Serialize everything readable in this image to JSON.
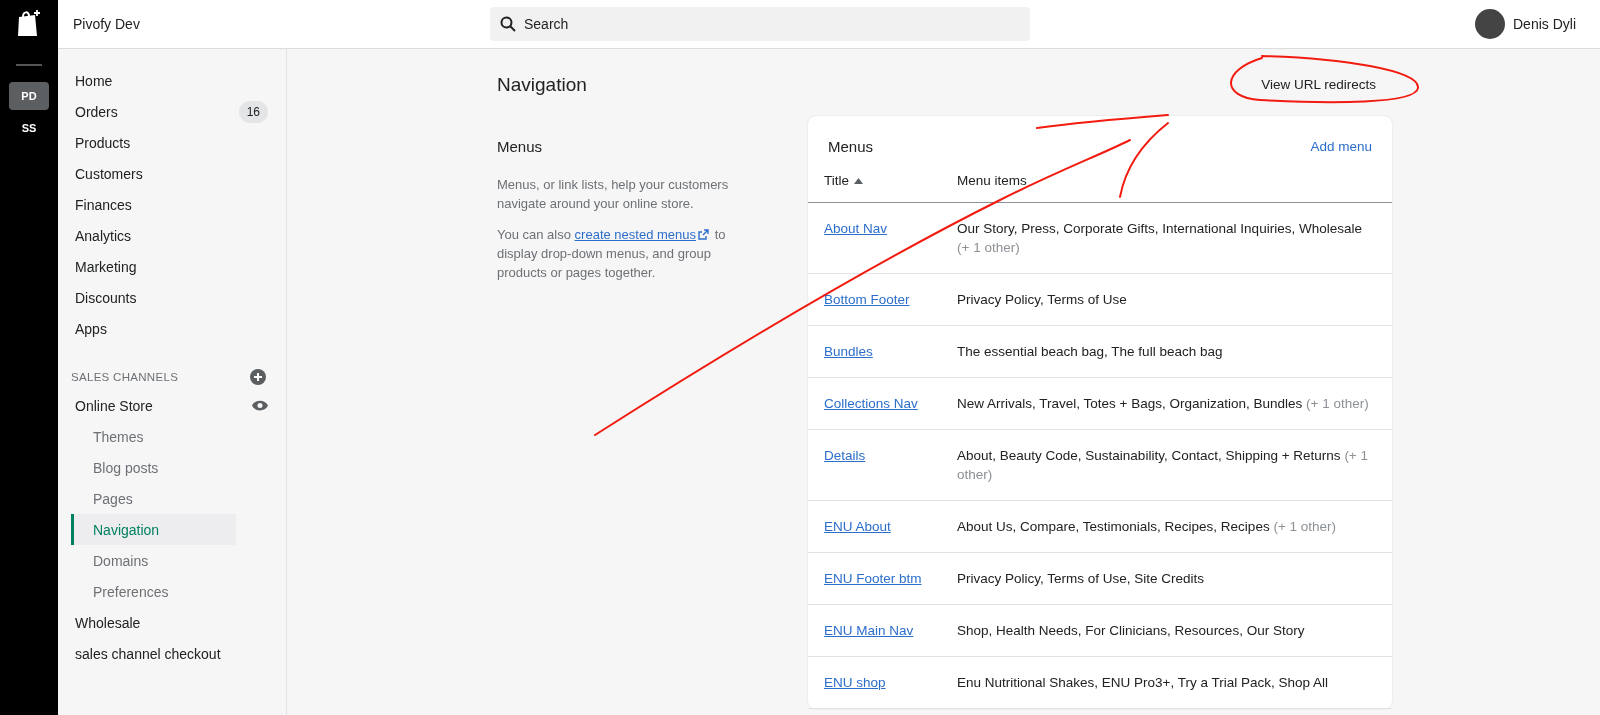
{
  "rail": {
    "stores": [
      {
        "label": "PD",
        "selected": true
      },
      {
        "label": "SS",
        "selected": false
      }
    ]
  },
  "topbar": {
    "store_name": "Pivofy Dev",
    "search": {
      "placeholder": "Search"
    },
    "user": "Denis Dyli"
  },
  "sidebar": {
    "items": [
      {
        "label": "Home"
      },
      {
        "label": "Orders",
        "badge": "16"
      },
      {
        "label": "Products"
      },
      {
        "label": "Customers"
      },
      {
        "label": "Finances"
      },
      {
        "label": "Analytics"
      },
      {
        "label": "Marketing"
      },
      {
        "label": "Discounts"
      },
      {
        "label": "Apps"
      }
    ],
    "sales_channels": {
      "heading": "SALES CHANNELS",
      "channels": [
        {
          "label": "Online Store",
          "children": [
            {
              "label": "Themes",
              "selected": false
            },
            {
              "label": "Blog posts",
              "selected": false
            },
            {
              "label": "Pages",
              "selected": false
            },
            {
              "label": "Navigation",
              "selected": true
            },
            {
              "label": "Domains",
              "selected": false
            },
            {
              "label": "Preferences",
              "selected": false
            }
          ]
        },
        {
          "label": "Wholesale"
        },
        {
          "label": "sales channel checkout"
        }
      ]
    }
  },
  "page": {
    "title": "Navigation",
    "action": "View URL redirects",
    "section": {
      "title": "Menus",
      "description": "Menus, or link lists, help your customers navigate around your online store.",
      "note_before": "You can also",
      "note_link": "create nested menus",
      "note_after": "to display drop-down menus, and group products or pages together."
    },
    "card": {
      "title": "Menus",
      "add": "Add menu",
      "columns": [
        "Title",
        "Menu items"
      ],
      "rows": [
        {
          "title": "About Nav",
          "items": "Our Story, Press, Corporate Gifts, International Inquiries, Wholesale",
          "more": "(+ 1 other)"
        },
        {
          "title": "Bottom Footer",
          "items": "Privacy Policy, Terms of Use"
        },
        {
          "title": "Bundles",
          "items": "The essential beach bag, The full beach bag"
        },
        {
          "title": "Collections Nav",
          "items": "New Arrivals, Travel, Totes + Bags, Organization, Bundles",
          "more": "(+ 1 other)"
        },
        {
          "title": "Details",
          "items": "About, Beauty Code, Sustainability, Contact, Shipping + Returns",
          "more": "(+ 1 other)"
        },
        {
          "title": "ENU About",
          "items": "About Us, Compare, Testimonials, Recipes, Recipes",
          "more": "(+ 1 other)"
        },
        {
          "title": "ENU Footer btm",
          "items": "Privacy Policy, Terms of Use, Site Credits"
        },
        {
          "title": "ENU Main Nav",
          "items": "Shop, Health Needs, For Clinicians, Resources, Our Story"
        },
        {
          "title": "ENU shop",
          "items": "Enu Nutritional Shakes, ENU Pro3+, Try a Trial Pack, Shop All"
        }
      ]
    }
  }
}
